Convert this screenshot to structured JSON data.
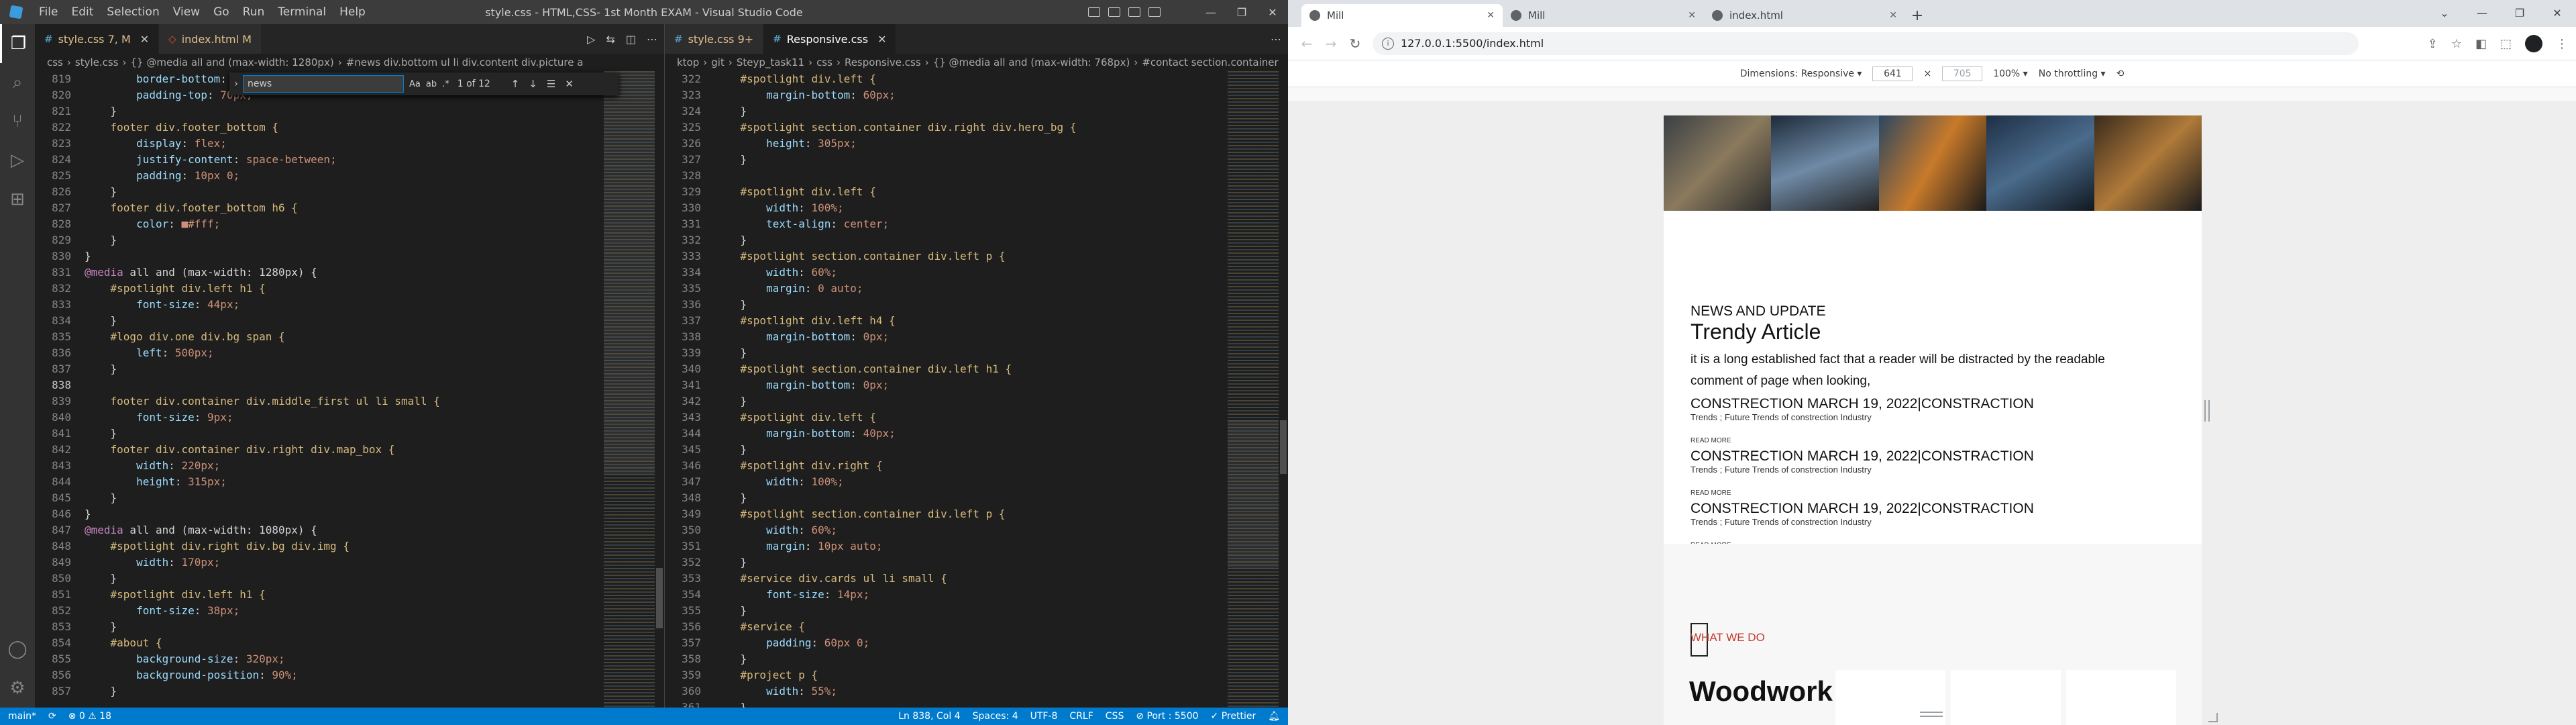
{
  "vscode": {
    "title": "style.css - HTML,CSS- 1st Month EXAM - Visual Studio Code",
    "menu": [
      "File",
      "Edit",
      "Selection",
      "View",
      "Go",
      "Run",
      "Terminal",
      "Help"
    ],
    "window_controls": [
      "—",
      "❐",
      "✕"
    ],
    "left": {
      "tabs": [
        {
          "label": "style.css 7, M",
          "icon": "#",
          "active": true
        },
        {
          "label": "index.html M",
          "icon": "◇",
          "active": false
        }
      ],
      "breadcrumb": [
        "css",
        "›",
        "style.css",
        "›",
        "{} @media all and (max-width: 1280px)",
        "›",
        "#news div.bottom ul li div.content div.picture a"
      ],
      "find": {
        "query": "news",
        "count": "1 of 12",
        "options": [
          "Aa",
          "ab",
          ".*"
        ]
      },
      "lines": [
        {
          "n": "819",
          "t": "        border-bottom: 1px solid"
        },
        {
          "n": "820",
          "t": "        padding-top: 70px;"
        },
        {
          "n": "821",
          "t": "    }"
        },
        {
          "n": "822",
          "t": "    footer div.footer_bottom {"
        },
        {
          "n": "823",
          "t": "        display: flex;"
        },
        {
          "n": "824",
          "t": "        justify-content: space-between;"
        },
        {
          "n": "825",
          "t": "        padding: 10px 0;"
        },
        {
          "n": "826",
          "t": "    }"
        },
        {
          "n": "827",
          "t": "    footer div.footer_bottom h6 {"
        },
        {
          "n": "828",
          "t": "        color: ■#fff;"
        },
        {
          "n": "829",
          "t": "    }"
        },
        {
          "n": "830",
          "t": "}"
        },
        {
          "n": "831",
          "t": "@media all and (max-width: 1280px) {"
        },
        {
          "n": "832",
          "t": "    #spotlight div.left h1 {"
        },
        {
          "n": "833",
          "t": "        font-size: 44px;"
        },
        {
          "n": "834",
          "t": "    }"
        },
        {
          "n": "835",
          "t": "    #logo div.one div.bg span {"
        },
        {
          "n": "836",
          "t": "        left: 500px;"
        },
        {
          "n": "837",
          "t": "    }"
        },
        {
          "n": "838",
          "t": "    "
        },
        {
          "n": "839",
          "t": "    footer div.container div.middle_first ul li small {"
        },
        {
          "n": "840",
          "t": "        font-size: 9px;"
        },
        {
          "n": "841",
          "t": "    }"
        },
        {
          "n": "842",
          "t": "    footer div.container div.right div.map_box {"
        },
        {
          "n": "843",
          "t": "        width: 220px;"
        },
        {
          "n": "844",
          "t": "        height: 315px;"
        },
        {
          "n": "845",
          "t": "    }"
        },
        {
          "n": "846",
          "t": "}"
        },
        {
          "n": "847",
          "t": "@media all and (max-width: 1080px) {"
        },
        {
          "n": "848",
          "t": "    #spotlight div.right div.bg div.img {"
        },
        {
          "n": "849",
          "t": "        width: 170px;"
        },
        {
          "n": "850",
          "t": "    }"
        },
        {
          "n": "851",
          "t": "    #spotlight div.left h1 {"
        },
        {
          "n": "852",
          "t": "        font-size: 38px;"
        },
        {
          "n": "853",
          "t": "    }"
        },
        {
          "n": "854",
          "t": "    #about {"
        },
        {
          "n": "855",
          "t": "        background-size: 320px;"
        },
        {
          "n": "856",
          "t": "        background-position: 90%;"
        },
        {
          "n": "857",
          "t": "    }"
        }
      ]
    },
    "right": {
      "tabs": [
        {
          "label": "style.css 9+",
          "icon": "#",
          "active": false
        },
        {
          "label": "Responsive.css",
          "icon": "#",
          "active": true
        }
      ],
      "breadcrumb": [
        "ktop",
        "›",
        "git",
        "›",
        "Steyp_task11",
        "›",
        "css",
        "›",
        "Responsive.css",
        "›",
        "{} @media all and (max-width: 768px)",
        "›",
        "#contact section.container"
      ],
      "lines": [
        {
          "n": "322",
          "t": "    #spotlight div.left {"
        },
        {
          "n": "323",
          "t": "        margin-bottom: 60px;"
        },
        {
          "n": "324",
          "t": "    }"
        },
        {
          "n": "325",
          "t": "    #spotlight section.container div.right div.hero_bg {"
        },
        {
          "n": "326",
          "t": "        height: 305px;"
        },
        {
          "n": "327",
          "t": "    }"
        },
        {
          "n": "328",
          "t": ""
        },
        {
          "n": "329",
          "t": "    #spotlight div.left {"
        },
        {
          "n": "330",
          "t": "        width: 100%;"
        },
        {
          "n": "331",
          "t": "        text-align: center;"
        },
        {
          "n": "332",
          "t": "    }"
        },
        {
          "n": "333",
          "t": "    #spotlight section.container div.left p {"
        },
        {
          "n": "334",
          "t": "        width: 60%;"
        },
        {
          "n": "335",
          "t": "        margin: 0 auto;"
        },
        {
          "n": "336",
          "t": "    }"
        },
        {
          "n": "337",
          "t": "    #spotlight div.left h4 {"
        },
        {
          "n": "338",
          "t": "        margin-bottom: 0px;"
        },
        {
          "n": "339",
          "t": "    }"
        },
        {
          "n": "340",
          "t": "    #spotlight section.container div.left h1 {"
        },
        {
          "n": "341",
          "t": "        margin-bottom: 0px;"
        },
        {
          "n": "342",
          "t": "    }"
        },
        {
          "n": "343",
          "t": "    #spotlight div.left {"
        },
        {
          "n": "344",
          "t": "        margin-bottom: 40px;"
        },
        {
          "n": "345",
          "t": "    }"
        },
        {
          "n": "346",
          "t": "    #spotlight div.right {"
        },
        {
          "n": "347",
          "t": "        width: 100%;"
        },
        {
          "n": "348",
          "t": "    }"
        },
        {
          "n": "349",
          "t": "    #spotlight section.container div.left p {"
        },
        {
          "n": "350",
          "t": "        width: 60%;"
        },
        {
          "n": "351",
          "t": "        margin: 10px auto;"
        },
        {
          "n": "352",
          "t": "    }"
        },
        {
          "n": "353",
          "t": "    #service div.cards ul li small {"
        },
        {
          "n": "354",
          "t": "        font-size: 14px;"
        },
        {
          "n": "355",
          "t": "    }"
        },
        {
          "n": "356",
          "t": "    #service {"
        },
        {
          "n": "357",
          "t": "        padding: 60px 0;"
        },
        {
          "n": "358",
          "t": "    }"
        },
        {
          "n": "359",
          "t": "    #project p {"
        },
        {
          "n": "360",
          "t": "        width: 55%;"
        },
        {
          "n": "361",
          "t": "    }"
        }
      ]
    },
    "status": {
      "branch": "main*",
      "sync": "⟳",
      "problems": "⊗ 0 ⚠ 18",
      "position": "Ln 838, Col 4",
      "spaces": "Spaces: 4",
      "encoding": "UTF-8",
      "eol": "CRLF",
      "language": "CSS",
      "port": "⊘ Port : 5500",
      "prettier": "✓ Prettier"
    }
  },
  "chrome": {
    "tabs": [
      {
        "label": "Mill",
        "active": true
      },
      {
        "label": "Mill",
        "active": false
      },
      {
        "label": "index.html",
        "active": false
      }
    ],
    "url": "127.0.0.1:5500/index.html",
    "devtools": {
      "dimensions": "Dimensions: Responsive ▾",
      "width": "641",
      "times": "×",
      "height": "705",
      "zoom": "100% ▾",
      "throttle": "No throttling ▾"
    },
    "page": {
      "news_label": "NEWS AND UPDATE",
      "news_title": "Trendy Article",
      "news_lead": "it is a long established fact that a reader will be distracted by the readable comment of page when looking,",
      "articles": [
        {
          "heading": "CONSTRECTION MARCH 19, 2022|CONSTRACTION",
          "sub": "Trends ; Future Trends of constrection Industry",
          "more": "READ MORE"
        },
        {
          "heading": "CONSTRECTION MARCH 19, 2022|CONSTRACTION",
          "sub": "Trends ; Future Trends of constrection Industry",
          "more": "READ MORE"
        },
        {
          "heading": "CONSTRECTION MARCH 19, 2022|CONSTRACTION",
          "sub": "Trends ; Future Trends of constrection Industry",
          "more": "READ MORE"
        }
      ],
      "service_label": "WHAT WE DO",
      "service_title": "Woodwork"
    }
  }
}
